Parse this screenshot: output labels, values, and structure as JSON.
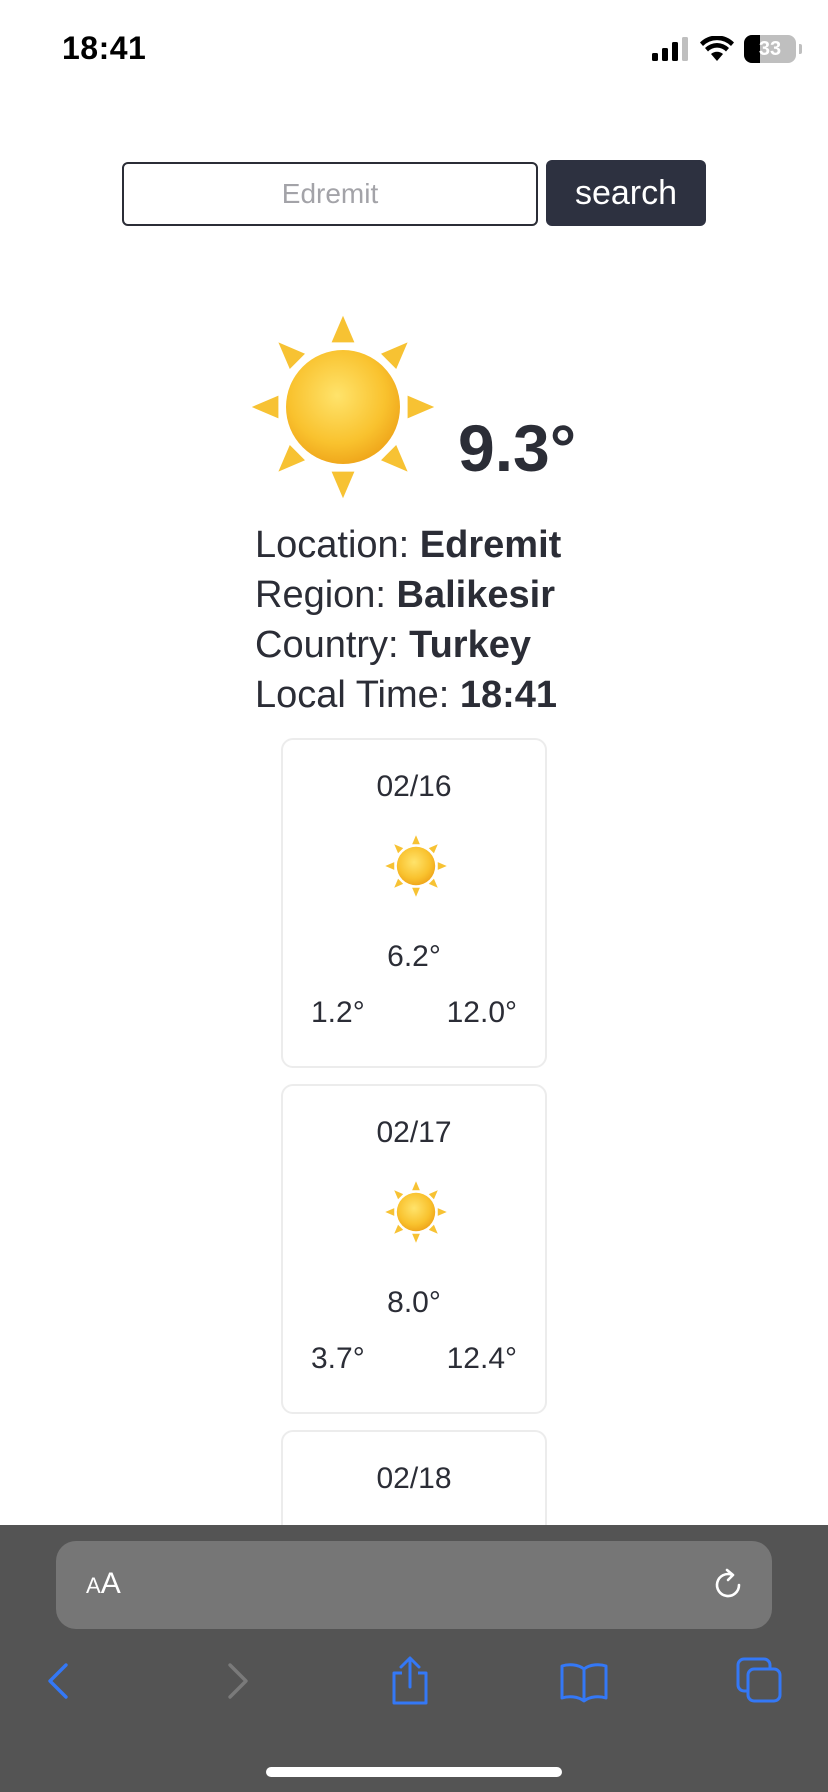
{
  "status_bar": {
    "time": "18:41",
    "battery": "33"
  },
  "search": {
    "placeholder": "Edremit",
    "value": "",
    "button_label": "search"
  },
  "current": {
    "icon": "sun-icon",
    "temperature": "9.3°",
    "location_label": "Location: ",
    "location": "Edremit",
    "region_label": "Region: ",
    "region": "Balikesir",
    "country_label": "Country: ",
    "country": "Turkey",
    "local_time_label": "Local Time: ",
    "local_time": "18:41"
  },
  "forecast": [
    {
      "date": "02/16",
      "icon": "sun-icon",
      "avg": "6.2°",
      "min": "1.2°",
      "max": "12.0°"
    },
    {
      "date": "02/17",
      "icon": "sun-icon",
      "avg": "8.0°",
      "min": "3.7°",
      "max": "12.4°"
    },
    {
      "date": "02/18"
    }
  ],
  "browser": {
    "aa_small": "A",
    "aa_large": "A",
    "accent_color": "#3478f6"
  }
}
